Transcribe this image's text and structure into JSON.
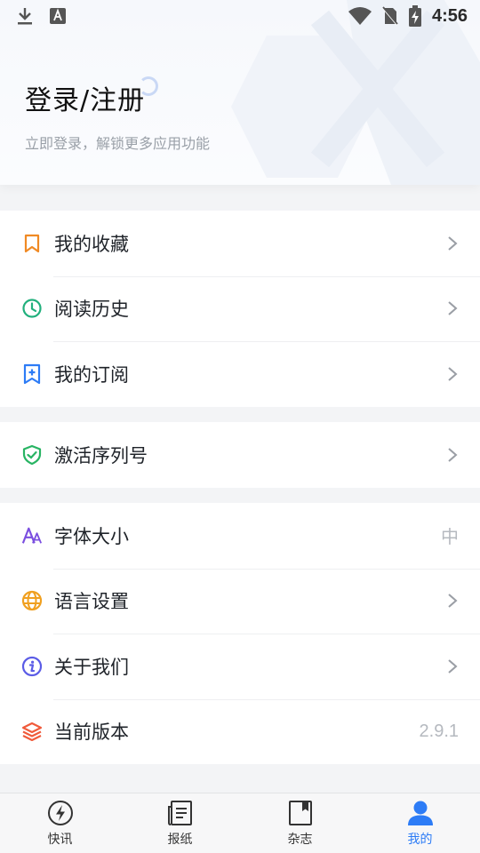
{
  "status_bar": {
    "time": "4:56",
    "left_icons": [
      "download-icon",
      "keyboard-a-icon"
    ],
    "right_icons": [
      "wifi-icon",
      "no-sim-icon",
      "battery-charging-icon"
    ]
  },
  "header": {
    "title": "登录/注册",
    "subtitle": "立即登录，解锁更多应用功能"
  },
  "groups": [
    {
      "items": [
        {
          "label": "我的收藏",
          "icon": "bookmark-icon",
          "icon_color": "#f08a24",
          "right": "chevron"
        },
        {
          "label": "阅读历史",
          "icon": "clock-icon",
          "icon_color": "#22b07d",
          "right": "chevron"
        },
        {
          "label": "我的订阅",
          "icon": "bookmark-plus-icon",
          "icon_color": "#2d7cf6",
          "right": "chevron"
        }
      ]
    },
    {
      "items": [
        {
          "label": "激活序列号",
          "icon": "shield-check-icon",
          "icon_color": "#28b463",
          "right": "chevron"
        }
      ]
    },
    {
      "items": [
        {
          "label": "字体大小",
          "icon": "font-size-icon",
          "icon_color": "#7b4fe0",
          "right": "value",
          "value": "中"
        },
        {
          "label": "语言设置",
          "icon": "globe-icon",
          "icon_color": "#f0a020",
          "right": "chevron"
        },
        {
          "label": "关于我们",
          "icon": "info-icon",
          "icon_color": "#5b5ce6",
          "right": "chevron"
        },
        {
          "label": "当前版本",
          "icon": "layers-icon",
          "icon_color": "#f05a3a",
          "right": "value",
          "value": "2.9.1"
        }
      ]
    }
  ],
  "tabbar": {
    "active": "我的",
    "active_color": "#2d7cf6",
    "tabs": [
      {
        "label": "快讯",
        "icon": "lightning-icon"
      },
      {
        "label": "报纸",
        "icon": "newspaper-icon"
      },
      {
        "label": "杂志",
        "icon": "magazine-icon"
      },
      {
        "label": "我的",
        "icon": "user-icon"
      }
    ]
  }
}
